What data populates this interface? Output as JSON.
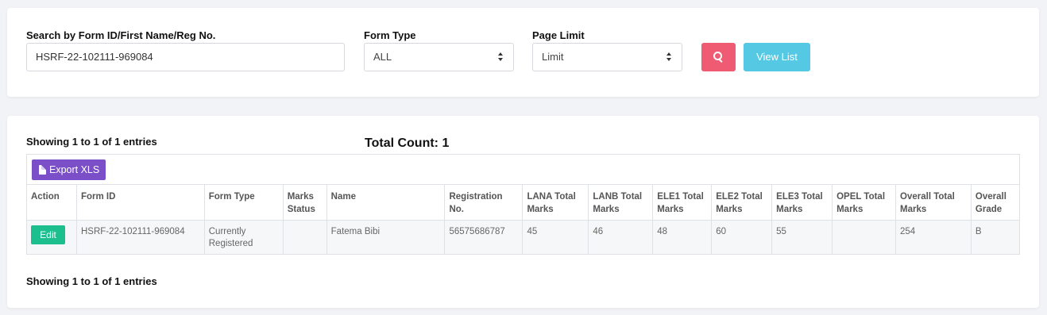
{
  "search": {
    "search_label": "Search by Form ID/First Name/Reg No.",
    "search_value": "HSRF-22-102111-969084",
    "form_type_label": "Form Type",
    "form_type_value": "ALL",
    "page_limit_label": "Page Limit",
    "page_limit_value": "Limit",
    "search_button_icon": "search-icon",
    "view_list_label": "View List",
    "colors": {
      "search_button": "#ef5b72",
      "view_list_button": "#55c8e3"
    }
  },
  "results": {
    "showing_top": "Showing 1 to 1 of 1 entries",
    "total_count": "Total Count: 1",
    "export_label": "Export XLS",
    "export_icon": "file-icon",
    "columns": [
      "Action",
      "Form ID",
      "Form Type",
      "Marks Status",
      "Name",
      "Registration No.",
      "LANA Total Marks",
      "LANB Total Marks",
      "ELE1 Total Marks",
      "ELE2 Total Marks",
      "ELE3 Total Marks",
      "OPEL Total Marks",
      "Overall Total Marks",
      "Overall Grade"
    ],
    "rows": [
      {
        "action": "Edit",
        "form_id": "HSRF-22-102111-969084",
        "form_type": "Currently Registered",
        "marks_status": "",
        "name": "Fatema Bibi",
        "registration_no": "56575686787",
        "lana": "45",
        "lanb": "46",
        "ele1": "48",
        "ele2": "60",
        "ele3": "55",
        "opel": "",
        "overall_total": "254",
        "overall_grade": "B"
      }
    ],
    "showing_bottom": "Showing 1 to 1 of 1 entries",
    "colors": {
      "export_button": "#7a4fc8",
      "edit_button": "#1ebf8f"
    }
  }
}
